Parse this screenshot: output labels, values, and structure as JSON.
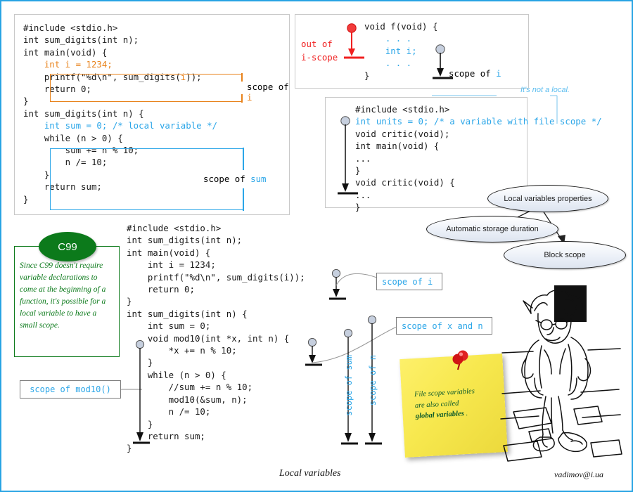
{
  "slide": {
    "caption": "Local variables",
    "credit": "vadimov@i.ua",
    "border_color": "#29A4E3"
  },
  "colors": {
    "accent_blue": "#2BA6E8",
    "accent_orange": "#E8821A",
    "accent_red": "#F02020",
    "c99_green": "#0C7A1B",
    "note_yellow": "#F7E84E",
    "note_text_green": "#0D5A2A",
    "panel_border": "#C8C8C8"
  },
  "panel1": {
    "code_lines": [
      [
        {
          "t": "#include <stdio.h>",
          "c": "plain"
        }
      ],
      [
        {
          "t": "int sum_digits(int n);",
          "c": "plain"
        }
      ],
      [
        {
          "t": "int main(void) {",
          "c": "plain"
        }
      ],
      [
        {
          "t": "    int i = 1234;",
          "c": "orange"
        }
      ],
      [
        {
          "t": "    printf(\"%d\\n\", sum_digits(",
          "c": "plain"
        },
        {
          "t": "i",
          "c": "orange"
        },
        {
          "t": "));",
          "c": "plain"
        }
      ],
      [
        {
          "t": "    return 0;",
          "c": "plain"
        }
      ],
      [
        {
          "t": "}",
          "c": "plain"
        }
      ],
      [
        {
          "t": "int sum_digits(int n) {",
          "c": "plain"
        }
      ],
      [
        {
          "t": "    int sum = 0; /* local variable */",
          "c": "blue"
        }
      ],
      [
        {
          "t": "    while (n > 0) {",
          "c": "plain"
        }
      ],
      [
        {
          "t": "        sum += n % 10;",
          "c": "plain"
        }
      ],
      [
        {
          "t": "        n /= 10;",
          "c": "plain"
        }
      ],
      [
        {
          "t": "    }",
          "c": "plain"
        }
      ],
      [
        {
          "t": "    return sum;",
          "c": "plain"
        }
      ],
      [
        {
          "t": "}",
          "c": "plain"
        }
      ]
    ],
    "scope_i_label_prefix": "scope of ",
    "scope_i_label_var": "i",
    "scope_sum_label_prefix": "scope of ",
    "scope_sum_label_var": "sum"
  },
  "panel2": {
    "out_of_scope_line1": "out of",
    "out_of_scope_line2": "i-scope",
    "code_lines": [
      [
        {
          "t": "void f(void) {",
          "c": "plain"
        }
      ],
      [
        {
          "t": "    . . .",
          "c": "blue"
        }
      ],
      [
        {
          "t": "    int i;",
          "c": "blue"
        }
      ],
      [
        {
          "t": "    . . .",
          "c": "blue"
        }
      ],
      [
        {
          "t": "}",
          "c": "plain"
        }
      ]
    ],
    "scope_i_label_prefix": "scope of ",
    "scope_i_label_var": "i"
  },
  "panel3": {
    "code_lines": [
      [
        {
          "t": "#include <stdio.h>",
          "c": "plain"
        }
      ],
      [
        {
          "t": "int units = 0; /* a variable with file scope */",
          "c": "blue"
        }
      ],
      [
        {
          "t": "void critic(void);",
          "c": "plain"
        }
      ],
      [
        {
          "t": "int main(void) {",
          "c": "plain"
        }
      ],
      [
        {
          "t": "...",
          "c": "plain"
        }
      ],
      [
        {
          "t": "}",
          "c": "plain"
        }
      ],
      [
        {
          "t": "void critic(void) {",
          "c": "plain"
        }
      ],
      [
        {
          "t": "...",
          "c": "plain"
        }
      ],
      [
        {
          "t": "}",
          "c": "plain"
        }
      ]
    ],
    "callout_note": "It's not a local."
  },
  "ellipses": {
    "root": "Local variables properties",
    "child_left": "Automatic storage duration",
    "child_right": "Block scope"
  },
  "c99": {
    "badge": "C99",
    "note": "Since C99 doesn't require variable declarations to come at the beginning of a function, it's possible for a local variable to have a small scope."
  },
  "main_code": {
    "lines": [
      [
        {
          "t": "#include <stdio.h>",
          "c": "plain"
        }
      ],
      [
        {
          "t": "int sum_digits(int n);",
          "c": "plain"
        }
      ],
      [
        {
          "t": "int main(void) {",
          "c": "plain"
        }
      ],
      [
        {
          "t": "    int i = 1234;",
          "c": "plain"
        }
      ],
      [
        {
          "t": "    printf(\"%d\\n\", sum_digits(i));",
          "c": "plain"
        }
      ],
      [
        {
          "t": "    return 0;",
          "c": "plain"
        }
      ],
      [
        {
          "t": "}",
          "c": "plain"
        }
      ],
      [
        {
          "t": "int sum_digits(int n) {",
          "c": "plain"
        }
      ],
      [
        {
          "t": "    int sum = 0;",
          "c": "plain"
        }
      ],
      [
        {
          "t": "    void mod10(int *x, int n) {",
          "c": "plain"
        }
      ],
      [
        {
          "t": "        *x += n % 10;",
          "c": "plain"
        }
      ],
      [
        {
          "t": "    }",
          "c": "plain"
        }
      ],
      [
        {
          "t": "    while (n > 0) {",
          "c": "plain"
        }
      ],
      [
        {
          "t": "        //sum += n % 10;",
          "c": "plain"
        }
      ],
      [
        {
          "t": "        mod10(&sum, n);",
          "c": "plain"
        }
      ],
      [
        {
          "t": "        n /= 10;",
          "c": "plain"
        }
      ],
      [
        {
          "t": "    }",
          "c": "plain"
        }
      ],
      [
        {
          "t": "    return sum;",
          "c": "plain"
        }
      ],
      [
        {
          "t": "}",
          "c": "plain"
        }
      ]
    ]
  },
  "scope_labels": {
    "mod10": "scope of mod10()",
    "i": "scope of i",
    "x_and_n": "scope of x and n",
    "sum_vertical": "scope of sum",
    "n_vertical": "scope of n"
  },
  "sticky": {
    "line1": "File scope variables",
    "line2": "are also called",
    "line3_bold": "global variables",
    "line3_tail": " ."
  }
}
